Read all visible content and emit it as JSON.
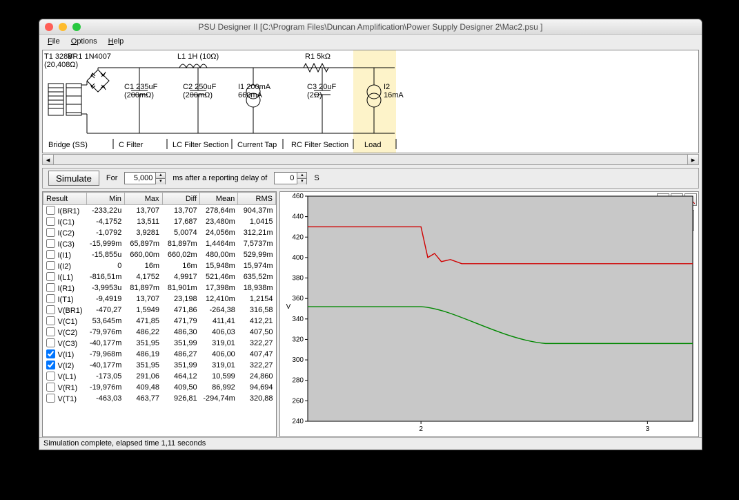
{
  "title": "PSU Designer II  [C:\\Program Files\\Duncan Amplification\\Power Supply Designer 2\\Mac2.psu ]",
  "menu": {
    "file": "File",
    "options": "Options",
    "help": "Help"
  },
  "schematic": {
    "bridge_top": "BR1 1N4007",
    "t1a": "T1 328V",
    "t1b": "(20,408Ω)",
    "l1": "L1 1H (10Ω)",
    "c1a": "C1 235uF",
    "c1b": "(200mΩ)",
    "c2a": "C2 250uF",
    "c2b": "(200mΩ)",
    "i1a": "I1 200mA",
    "i1b": "660mA",
    "r1": "R1 5kΩ",
    "c3a": "C3 20uF",
    "c3b": "(2Ω)",
    "i2a": "I2",
    "i2b": "16mA",
    "sec_bridge": "Bridge (SS)",
    "sec_c": "C Filter",
    "sec_lc": "LC Filter Section",
    "sec_tap": "Current Tap",
    "sec_rc": "RC Filter Section",
    "sec_load": "Load"
  },
  "simbar": {
    "simulate": "Simulate",
    "for": "For",
    "for_val": "5,000",
    "ms": "ms  after a reporting delay of",
    "delay_val": "0",
    "s": "S"
  },
  "table": {
    "headers": [
      "Result",
      "Min",
      "Max",
      "Diff",
      "Mean",
      "RMS"
    ],
    "rows": [
      {
        "chk": false,
        "name": "I(BR1)",
        "vals": [
          "-233,22u",
          "13,707",
          "13,707",
          "278,64m",
          "904,37m"
        ]
      },
      {
        "chk": false,
        "name": "I(C1)",
        "vals": [
          "-4,1752",
          "13,511",
          "17,687",
          "23,480m",
          "1,0415"
        ]
      },
      {
        "chk": false,
        "name": "I(C2)",
        "vals": [
          "-1,0792",
          "3,9281",
          "5,0074",
          "24,056m",
          "312,21m"
        ]
      },
      {
        "chk": false,
        "name": "I(C3)",
        "vals": [
          "-15,999m",
          "65,897m",
          "81,897m",
          "1,4464m",
          "7,5737m"
        ]
      },
      {
        "chk": false,
        "name": "I(I1)",
        "vals": [
          "-15,855u",
          "660,00m",
          "660,02m",
          "480,00m",
          "529,99m"
        ]
      },
      {
        "chk": false,
        "name": "I(I2)",
        "vals": [
          "0",
          "16m",
          "16m",
          "15,948m",
          "15,974m"
        ]
      },
      {
        "chk": false,
        "name": "I(L1)",
        "vals": [
          "-816,51m",
          "4,1752",
          "4,9917",
          "521,46m",
          "635,52m"
        ]
      },
      {
        "chk": false,
        "name": "I(R1)",
        "vals": [
          "-3,9953u",
          "81,897m",
          "81,901m",
          "17,398m",
          "18,938m"
        ]
      },
      {
        "chk": false,
        "name": "I(T1)",
        "vals": [
          "-9,4919",
          "13,707",
          "23,198",
          "12,410m",
          "1,2154"
        ]
      },
      {
        "chk": false,
        "name": "V(BR1)",
        "vals": [
          "-470,27",
          "1,5949",
          "471,86",
          "-264,38",
          "316,58"
        ]
      },
      {
        "chk": false,
        "name": "V(C1)",
        "vals": [
          "53,645m",
          "471,85",
          "471,79",
          "411,41",
          "412,21"
        ]
      },
      {
        "chk": false,
        "name": "V(C2)",
        "vals": [
          "-79,976m",
          "486,22",
          "486,30",
          "406,03",
          "407,50"
        ]
      },
      {
        "chk": false,
        "name": "V(C3)",
        "vals": [
          "-40,177m",
          "351,95",
          "351,99",
          "319,01",
          "322,27"
        ]
      },
      {
        "chk": true,
        "name": "V(I1)",
        "vals": [
          "-79,968m",
          "486,19",
          "486,27",
          "406,00",
          "407,47"
        ]
      },
      {
        "chk": true,
        "name": "V(I2)",
        "vals": [
          "-40,177m",
          "351,95",
          "351,99",
          "319,01",
          "322,27"
        ]
      },
      {
        "chk": false,
        "name": "V(L1)",
        "vals": [
          "-173,05",
          "291,06",
          "464,12",
          "10,599",
          "24,860"
        ]
      },
      {
        "chk": false,
        "name": "V(R1)",
        "vals": [
          "-19,976m",
          "409,48",
          "409,50",
          "86,992",
          "94,694"
        ]
      },
      {
        "chk": false,
        "name": "V(T1)",
        "vals": [
          "-463,03",
          "463,77",
          "926,81",
          "-294,74m",
          "320,88"
        ]
      }
    ]
  },
  "chart": {
    "legend": [
      {
        "name": "V(I1)",
        "color": "#d00000"
      },
      {
        "name": "V(I2)",
        "color": "#008800"
      }
    ],
    "ylabel": "V",
    "yticks": [
      240,
      260,
      280,
      300,
      320,
      340,
      360,
      380,
      400,
      420,
      440,
      460
    ],
    "xticks": [
      2,
      3
    ]
  },
  "status": "Simulation complete, elapsed time 1,11 seconds"
}
